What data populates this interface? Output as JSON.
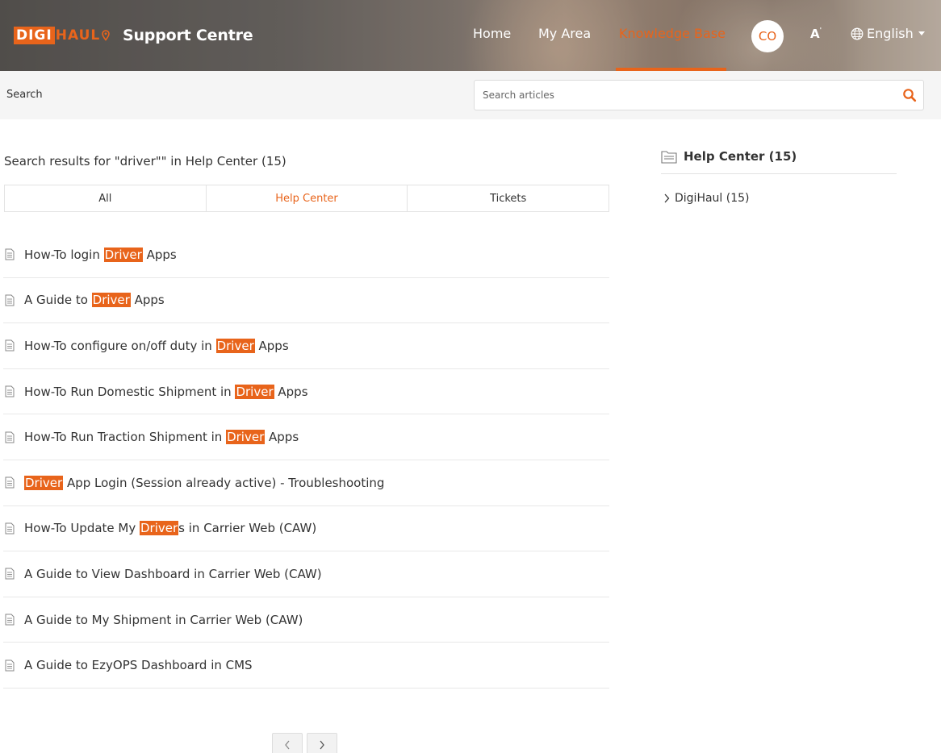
{
  "header": {
    "logo": {
      "box_text": "DIGI",
      "text": "HAUL"
    },
    "site_title": "Support Centre",
    "nav": [
      {
        "label": "Home",
        "active": false
      },
      {
        "label": "My Area",
        "active": false
      },
      {
        "label": "Knowledge Base",
        "active": true
      }
    ],
    "avatar_initials": "CO",
    "font_size_icon": "A",
    "language": "English"
  },
  "search": {
    "label": "Search",
    "placeholder": "Search articles",
    "value": ""
  },
  "results": {
    "heading": "Search results for \"driver\"\" in Help Center (15)",
    "tabs": [
      {
        "label": "All",
        "active": false
      },
      {
        "label": "Help Center",
        "active": true
      },
      {
        "label": "Tickets",
        "active": false
      }
    ],
    "items": [
      {
        "before": "How-To login ",
        "match": "Driver",
        "after": " Apps"
      },
      {
        "before": "A Guide to ",
        "match": "Driver",
        "after": " Apps"
      },
      {
        "before": "How-To configure on/off duty in ",
        "match": "Driver",
        "after": " Apps"
      },
      {
        "before": "How-To Run Domestic Shipment in ",
        "match": "Driver",
        "after": " Apps"
      },
      {
        "before": "How-To Run Traction Shipment in ",
        "match": "Driver",
        "after": " Apps"
      },
      {
        "before": "",
        "match": "Driver",
        "after": " App Login (Session already active) - Troubleshooting"
      },
      {
        "before": "How-To Update My ",
        "match": "Driver",
        "after": "s in Carrier Web (CAW)"
      },
      {
        "before": "A Guide to View Dashboard in Carrier Web (CAW)",
        "match": "",
        "after": ""
      },
      {
        "before": "A Guide to My Shipment in Carrier Web (CAW)",
        "match": "",
        "after": ""
      },
      {
        "before": "A Guide to EzyOPS Dashboard in CMS",
        "match": "",
        "after": ""
      }
    ]
  },
  "sidebar": {
    "heading": "Help Center (15)",
    "items": [
      {
        "label": "DigiHaul (15)"
      }
    ]
  },
  "colors": {
    "accent": "#e8641b",
    "text": "#333333",
    "border": "#e3e3e3",
    "searchbar_bg": "#f5f5f5"
  },
  "icons": {
    "logo_pin": "location-pin-icon",
    "font_size": "font-size-icon",
    "language": "globe-icon",
    "search": "search-icon",
    "result": "document-icon",
    "sidebar_heading": "folder-icon",
    "sidebar_item": "chevron-right-icon",
    "pager_prev": "chevron-left-icon",
    "pager_next": "chevron-right-icon"
  }
}
